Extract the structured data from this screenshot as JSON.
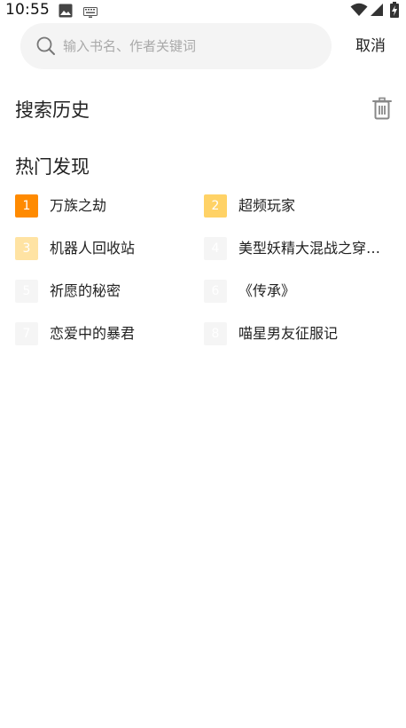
{
  "status_bar": {
    "time": "10:55",
    "icons": [
      "image-icon",
      "keyboard-icon",
      "wifi-icon",
      "signal-icon",
      "battery-charging-icon"
    ]
  },
  "search": {
    "placeholder": "输入书名、作者关键词",
    "value": "",
    "cancel_label": "取消"
  },
  "history": {
    "title": "搜索历史",
    "clear_icon": "trash-icon"
  },
  "hot": {
    "title": "热门发现",
    "items": [
      {
        "rank": "1",
        "name": "万族之劫",
        "badge_color": "#ff8a00"
      },
      {
        "rank": "2",
        "name": "超频玩家",
        "badge_color": "#ffd266"
      },
      {
        "rank": "3",
        "name": "机器人回收站",
        "badge_color": "#ffe3a3"
      },
      {
        "rank": "4",
        "name": "美型妖精大混战之穿越者",
        "badge_color": "#f5f5f5"
      },
      {
        "rank": "5",
        "name": "祈愿的秘密",
        "badge_color": "#f5f5f5"
      },
      {
        "rank": "6",
        "name": "《传承》",
        "badge_color": "#f5f5f5"
      },
      {
        "rank": "7",
        "name": "恋爱中的暴君",
        "badge_color": "#f5f5f5"
      },
      {
        "rank": "8",
        "name": "喵星男友征服记",
        "badge_color": "#f5f5f5"
      }
    ]
  }
}
